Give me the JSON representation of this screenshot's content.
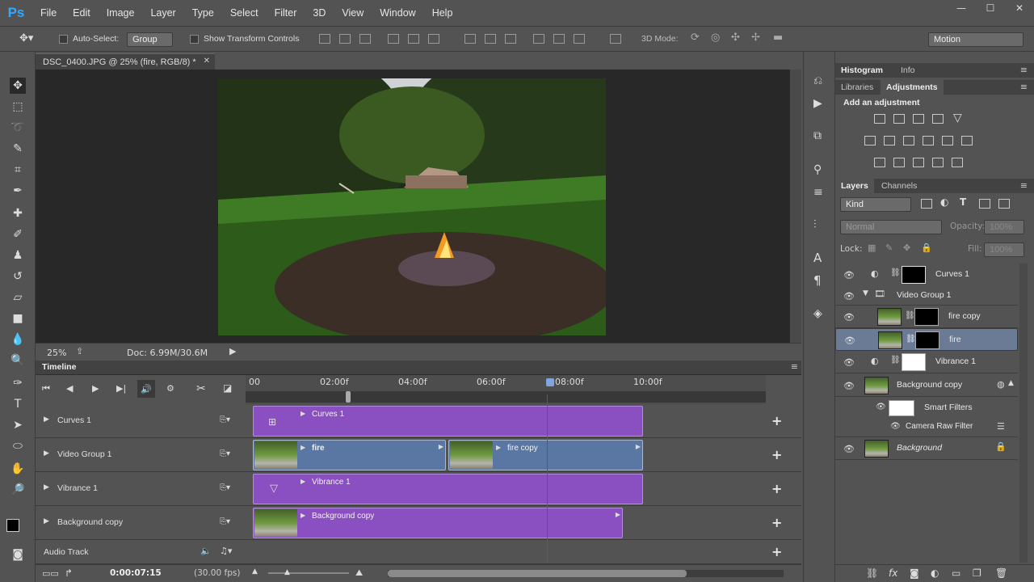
{
  "app": {
    "logo": "Ps"
  },
  "menu": [
    "File",
    "Edit",
    "Image",
    "Layer",
    "Type",
    "Select",
    "Filter",
    "3D",
    "View",
    "Window",
    "Help"
  ],
  "window_buttons": {
    "minimize": "—",
    "maximize": "☐",
    "close": "✕"
  },
  "options": {
    "auto_select_label": "Auto-Select:",
    "auto_select_value": "Group",
    "transform_label": "Show Transform Controls",
    "mode3d_label": "3D Mode:",
    "workspace": "Motion"
  },
  "document": {
    "tab_title": "DSC_0400.JPG @ 25% (fire, RGB/8) *",
    "zoom": "25%",
    "doc_info": "Doc: 6.99M/30.6M"
  },
  "timeline": {
    "title": "Timeline",
    "ruler": [
      "00",
      "02:00f",
      "04:00f",
      "06:00f",
      "08:00f",
      "10:00f"
    ],
    "timecode": "0:00:07:15",
    "fps": "(30.00 fps)",
    "audio_track": "Audio Track",
    "tracks": [
      {
        "name": "Curves 1",
        "clips": [
          {
            "label": "Curves 1"
          }
        ]
      },
      {
        "name": "Video Group 1",
        "clips": [
          {
            "label": "fire"
          },
          {
            "label": "fire copy"
          }
        ]
      },
      {
        "name": "Vibrance 1",
        "clips": [
          {
            "label": "Vibrance 1"
          }
        ]
      },
      {
        "name": "Background copy",
        "clips": [
          {
            "label": "Background copy"
          }
        ]
      }
    ]
  },
  "panels": {
    "tabs_top": [
      "Histogram",
      "Info"
    ],
    "tabs_mid": [
      "Libraries",
      "Adjustments"
    ],
    "add_adjustment": "Add an adjustment",
    "tabs_layers": [
      "Layers",
      "Channels"
    ],
    "kind_filter": "Kind",
    "blend_mode": "Normal",
    "opacity_label": "Opacity:",
    "opacity_value": "100%",
    "lock_label": "Lock:",
    "fill_label": "Fill:",
    "fill_value": "100%"
  },
  "layers": [
    {
      "name": "Curves 1"
    },
    {
      "name": "Video Group 1"
    },
    {
      "name": "fire copy"
    },
    {
      "name": "fire"
    },
    {
      "name": "Vibrance 1"
    },
    {
      "name": "Background copy"
    },
    {
      "name": "Smart Filters"
    },
    {
      "name": "Camera Raw Filter"
    },
    {
      "name": "Background"
    }
  ]
}
